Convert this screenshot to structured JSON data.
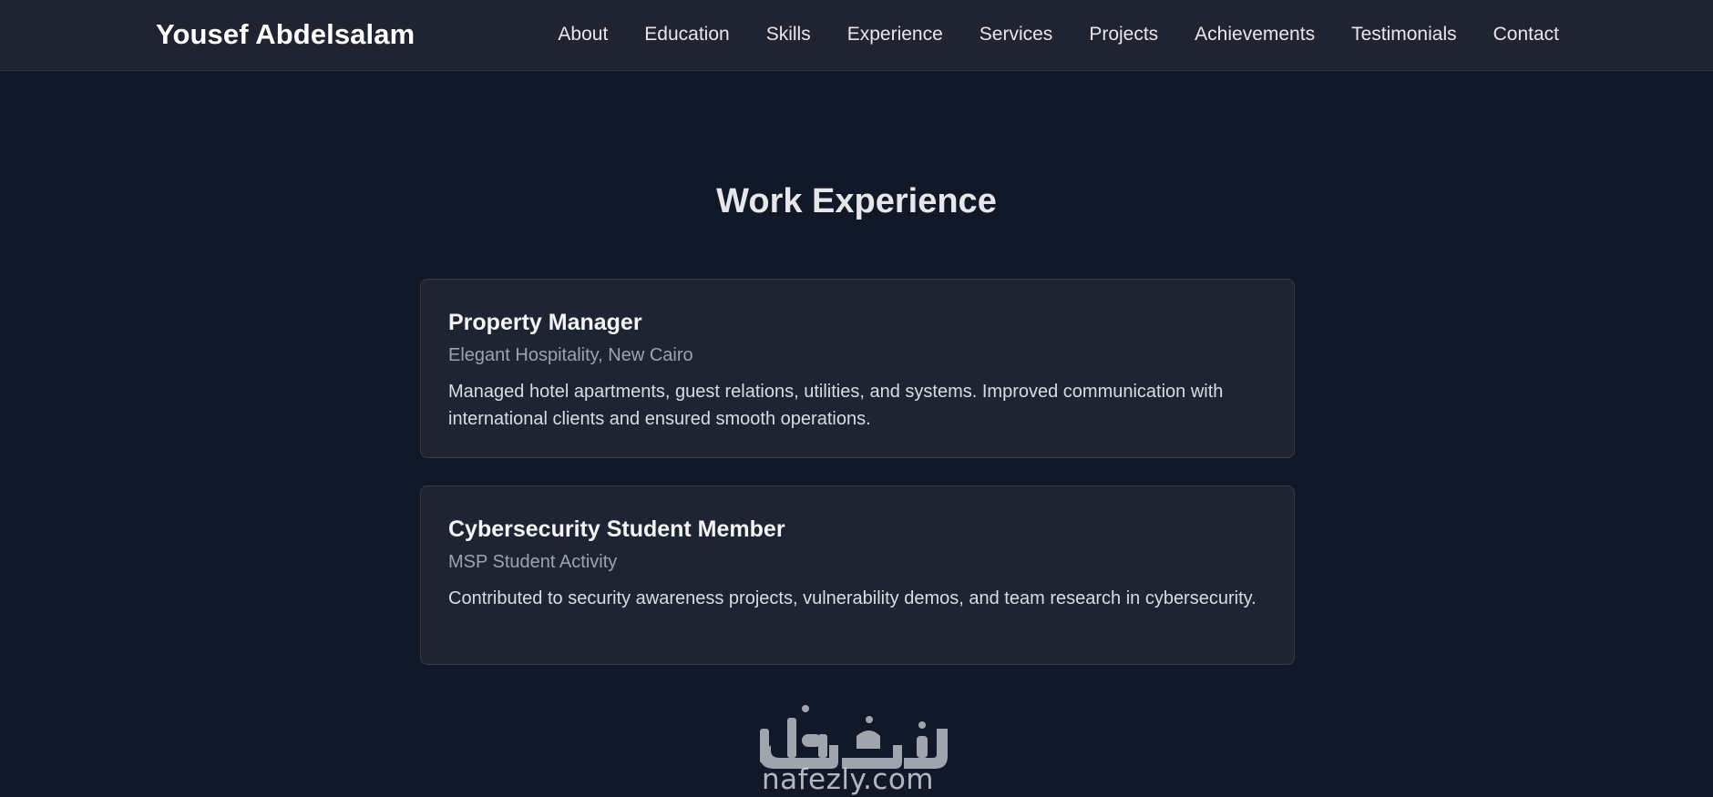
{
  "header": {
    "brand": "Yousef Abdelsalam",
    "nav": [
      {
        "label": "About"
      },
      {
        "label": "Education"
      },
      {
        "label": "Skills"
      },
      {
        "label": "Experience"
      },
      {
        "label": "Services"
      },
      {
        "label": "Projects"
      },
      {
        "label": "Achievements"
      },
      {
        "label": "Testimonials"
      },
      {
        "label": "Contact"
      }
    ]
  },
  "experience": {
    "title": "Work Experience",
    "items": [
      {
        "role": "Property Manager",
        "company": "Elegant Hospitality, New Cairo",
        "description": "Managed hotel apartments, guest relations, utilities, and systems. Improved communication with international clients and ensured smooth operations."
      },
      {
        "role": "Cybersecurity Student Member",
        "company": "MSP Student Activity",
        "description": "Contributed to security awareness projects, vulnerability demos, and team research in cybersecurity."
      }
    ]
  },
  "watermark": {
    "arabic": "نفذلي",
    "domain": "nafezly.com"
  },
  "colors": {
    "background": "#111827",
    "navbar": "#1f2430",
    "card": "#1f2432",
    "card_border": "#323a4b",
    "text": "#e5e7eb",
    "muted": "#9ca3af"
  }
}
